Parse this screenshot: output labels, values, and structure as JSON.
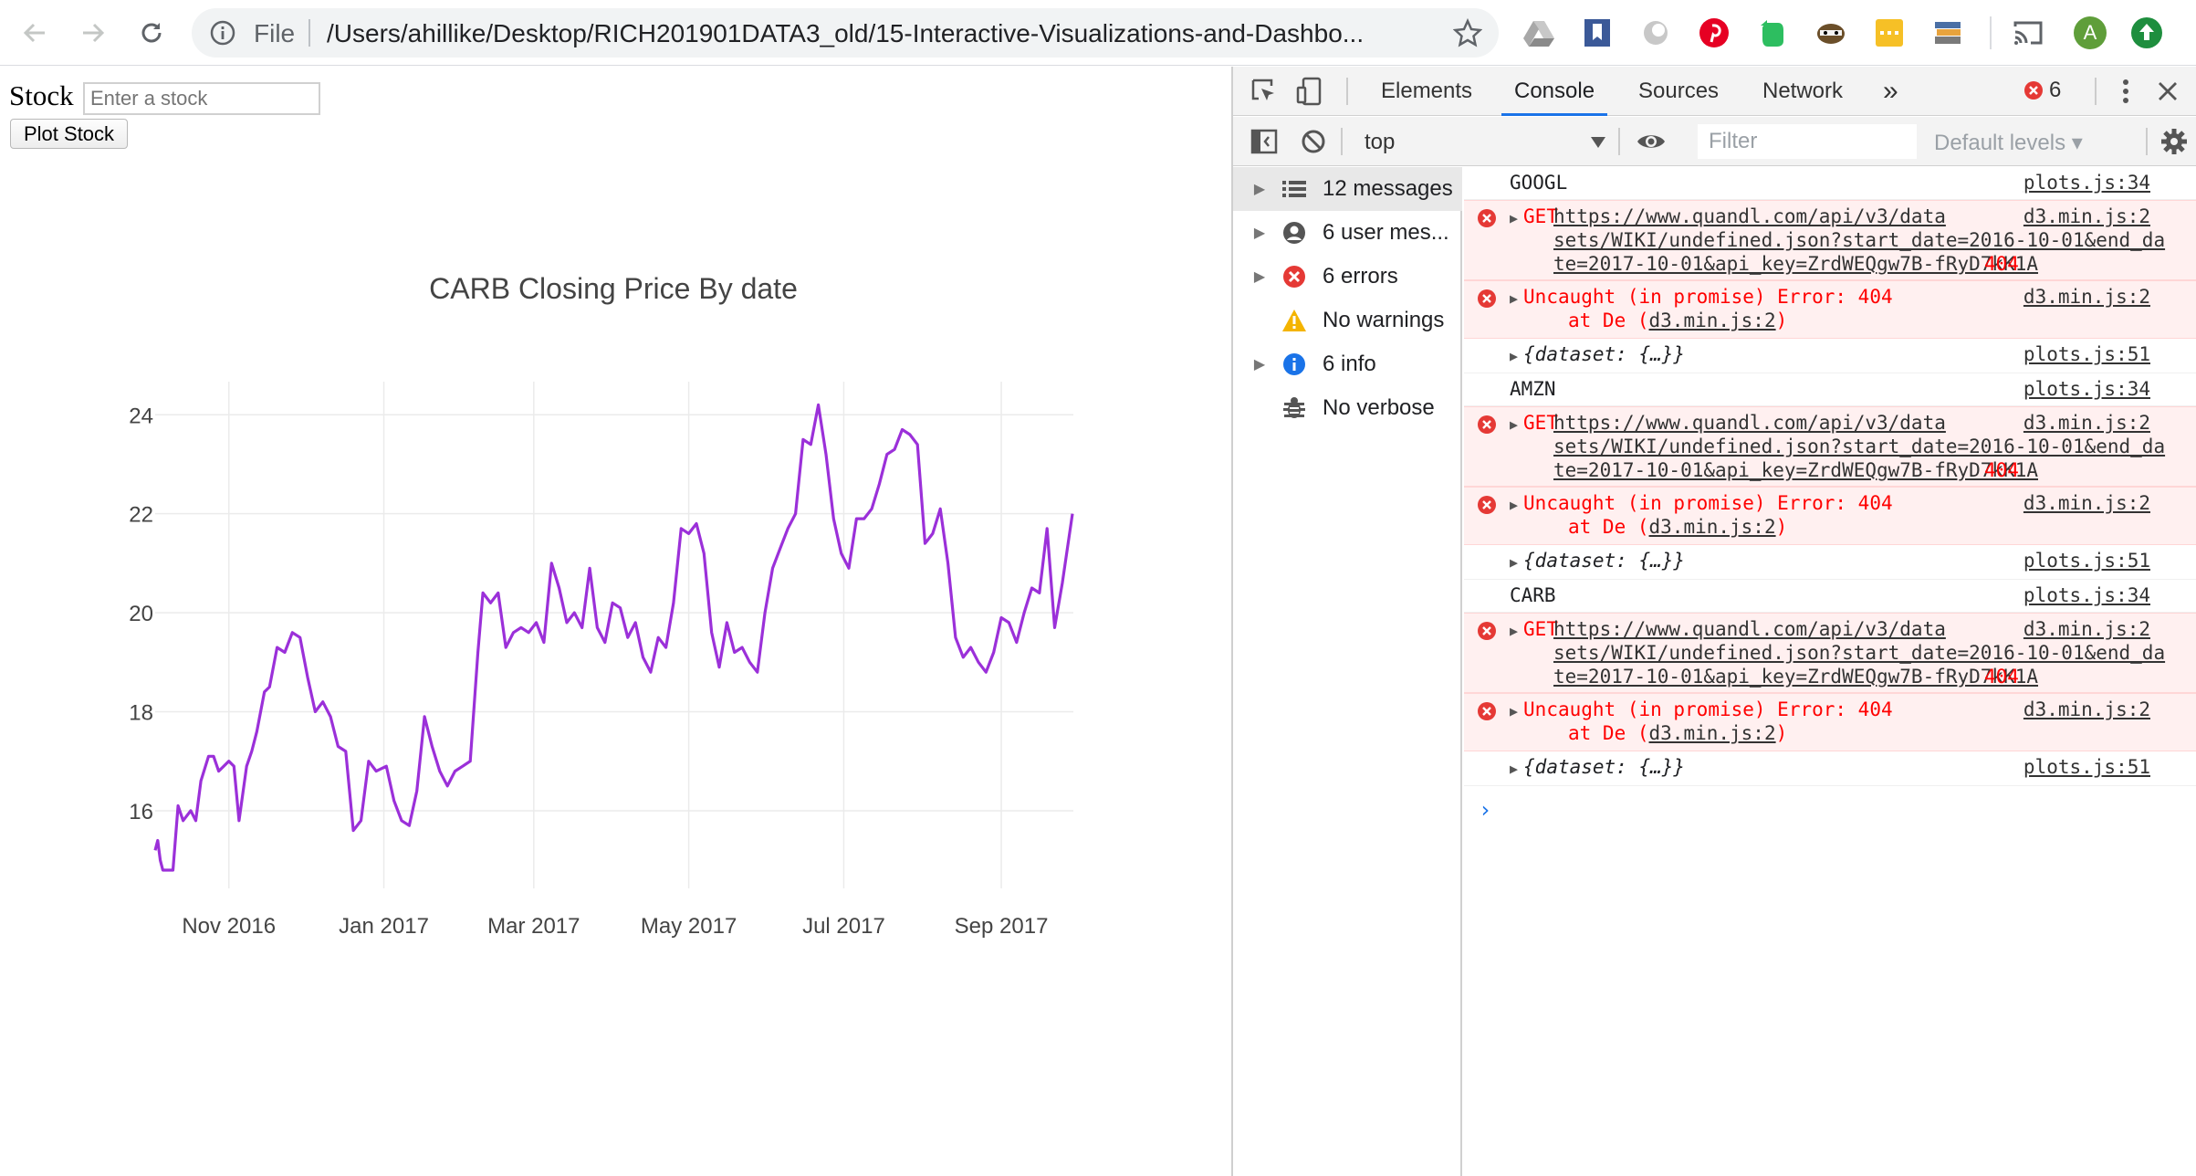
{
  "browser": {
    "file_label": "File",
    "url": "/Users/ahillike/Desktop/RICH201901DATA3_old/15-Interactive-Visualizations-and-Dashbo...",
    "profile_initial": "A"
  },
  "page": {
    "stock_label": "Stock",
    "stock_placeholder": "Enter a stock",
    "plot_button": "Plot Stock"
  },
  "chart_data": {
    "type": "line",
    "title": "CARB Closing Price By date",
    "color": "#9b30d9",
    "x_ticks": [
      "Nov 2016",
      "Jan 2017",
      "Mar 2017",
      "May 2017",
      "Jul 2017",
      "Sep 2017"
    ],
    "y_ticks": [
      16,
      18,
      20,
      22,
      24
    ],
    "ylim": [
      14.8,
      24.3
    ],
    "xlim": [
      "2016-10-03",
      "2017-09-29"
    ],
    "series": [
      {
        "x": [
          "2016-10-03",
          "2016-10-04",
          "2016-10-05",
          "2016-10-06",
          "2016-10-10",
          "2016-10-12",
          "2016-10-14",
          "2016-10-17",
          "2016-10-19",
          "2016-10-21",
          "2016-10-24",
          "2016-10-26",
          "2016-10-28",
          "2016-11-01",
          "2016-11-03",
          "2016-11-05",
          "2016-11-08",
          "2016-11-10",
          "2016-11-12",
          "2016-11-15",
          "2016-11-17",
          "2016-11-20",
          "2016-11-23",
          "2016-11-26",
          "2016-11-29",
          "2016-12-02",
          "2016-12-05",
          "2016-12-08",
          "2016-12-11",
          "2016-12-14",
          "2016-12-17",
          "2016-12-20",
          "2016-12-23",
          "2016-12-26",
          "2016-12-29",
          "2017-01-02",
          "2017-01-05",
          "2017-01-08",
          "2017-01-11",
          "2017-01-14",
          "2017-01-17",
          "2017-01-20",
          "2017-01-23",
          "2017-01-26",
          "2017-01-29",
          "2017-02-01",
          "2017-02-04",
          "2017-02-07",
          "2017-02-09",
          "2017-02-12",
          "2017-02-15",
          "2017-02-18",
          "2017-02-21",
          "2017-02-24",
          "2017-02-27",
          "2017-03-02",
          "2017-03-05",
          "2017-03-08",
          "2017-03-11",
          "2017-03-14",
          "2017-03-17",
          "2017-03-20",
          "2017-03-23",
          "2017-03-26",
          "2017-03-29",
          "2017-04-01",
          "2017-04-04",
          "2017-04-07",
          "2017-04-10",
          "2017-04-13",
          "2017-04-16",
          "2017-04-19",
          "2017-04-22",
          "2017-04-25",
          "2017-04-28",
          "2017-05-01",
          "2017-05-04",
          "2017-05-07",
          "2017-05-10",
          "2017-05-13",
          "2017-05-16",
          "2017-05-19",
          "2017-05-22",
          "2017-05-25",
          "2017-05-28",
          "2017-05-31",
          "2017-06-03",
          "2017-06-06",
          "2017-06-09",
          "2017-06-12",
          "2017-06-15",
          "2017-06-18",
          "2017-06-21",
          "2017-06-24",
          "2017-06-27",
          "2017-06-30",
          "2017-07-03",
          "2017-07-06",
          "2017-07-09",
          "2017-07-12",
          "2017-07-15",
          "2017-07-18",
          "2017-07-21",
          "2017-07-24",
          "2017-07-27",
          "2017-07-30",
          "2017-08-02",
          "2017-08-05",
          "2017-08-08",
          "2017-08-11",
          "2017-08-14",
          "2017-08-17",
          "2017-08-20",
          "2017-08-23",
          "2017-08-26",
          "2017-08-29",
          "2017-09-01",
          "2017-09-04",
          "2017-09-07",
          "2017-09-10",
          "2017-09-13",
          "2017-09-16",
          "2017-09-19",
          "2017-09-22",
          "2017-09-25",
          "2017-09-29"
        ],
        "y": [
          15.2,
          15.4,
          15.0,
          14.8,
          14.8,
          16.1,
          15.8,
          16.0,
          15.8,
          16.6,
          17.1,
          17.1,
          16.8,
          17.0,
          16.9,
          15.8,
          16.9,
          17.2,
          17.6,
          18.4,
          18.5,
          19.3,
          19.2,
          19.6,
          19.5,
          18.7,
          18.0,
          18.2,
          17.9,
          17.3,
          17.2,
          15.6,
          15.8,
          17.0,
          16.8,
          16.9,
          16.2,
          15.8,
          15.7,
          16.4,
          17.9,
          17.3,
          16.8,
          16.5,
          16.8,
          16.9,
          17.0,
          19.2,
          20.4,
          20.2,
          20.4,
          19.3,
          19.6,
          19.7,
          19.6,
          19.8,
          19.4,
          21.0,
          20.5,
          19.8,
          20.0,
          19.7,
          20.9,
          19.7,
          19.4,
          20.2,
          20.1,
          19.5,
          19.8,
          19.1,
          18.8,
          19.5,
          19.3,
          20.2,
          21.7,
          21.6,
          21.8,
          21.2,
          19.6,
          18.9,
          19.8,
          19.2,
          19.3,
          19.0,
          18.8,
          20.0,
          20.9,
          21.3,
          21.7,
          22.0,
          23.5,
          23.4,
          24.2,
          23.2,
          21.9,
          21.2,
          20.9,
          21.9,
          21.9,
          22.1,
          22.6,
          23.2,
          23.3,
          23.7,
          23.6,
          23.4,
          21.4,
          21.6,
          22.1,
          21.0,
          19.5,
          19.1,
          19.3,
          19.0,
          18.8,
          19.2,
          19.9,
          19.8,
          19.4,
          20.0,
          20.5,
          20.4,
          21.7,
          19.7,
          20.6,
          22.0
        ]
      }
    ]
  },
  "devtools": {
    "tabs": [
      "Elements",
      "Console",
      "Sources",
      "Network"
    ],
    "more_tabs": "»",
    "error_count": "6",
    "context": "top",
    "filter_placeholder": "Filter",
    "levels": "Default levels ▾",
    "sidebar": [
      {
        "label": "12 messages",
        "icon": "list-icon"
      },
      {
        "label": "6 user mes...",
        "icon": "user-icon"
      },
      {
        "label": "6 errors",
        "icon": "error-icon"
      },
      {
        "label": "No warnings",
        "icon": "warning-icon"
      },
      {
        "label": "6 info",
        "icon": "info-icon"
      },
      {
        "label": "No verbose",
        "icon": "bug-icon"
      }
    ],
    "messages": [
      {
        "kind": "log",
        "text": "GOOGL",
        "source": "plots.js:34"
      },
      {
        "kind": "get",
        "method": "GET",
        "url": "https://www.quandl.com/api/v3/data\nsets/WIKI/undefined.json?start_date=2016-10-01&end_da\nte=2017-10-01&api_key=ZrdWEQgw7B-fRyD7kK1A",
        "status": "404",
        "source": "d3.min.js:2"
      },
      {
        "kind": "uncaught",
        "text": "Uncaught (in promise) Error: 404",
        "at": "at De (",
        "at_link": "d3.min.js:2",
        "at_end": ")",
        "source": "d3.min.js:2"
      },
      {
        "kind": "obj",
        "text": "{dataset: {…}}",
        "source": "plots.js:51"
      },
      {
        "kind": "log",
        "text": "AMZN",
        "source": "plots.js:34"
      },
      {
        "kind": "get",
        "method": "GET",
        "url": "https://www.quandl.com/api/v3/data\nsets/WIKI/undefined.json?start_date=2016-10-01&end_da\nte=2017-10-01&api_key=ZrdWEQgw7B-fRyD7kK1A",
        "status": "404",
        "source": "d3.min.js:2"
      },
      {
        "kind": "uncaught",
        "text": "Uncaught (in promise) Error: 404",
        "at": "at De (",
        "at_link": "d3.min.js:2",
        "at_end": ")",
        "source": "d3.min.js:2"
      },
      {
        "kind": "obj",
        "text": "{dataset: {…}}",
        "source": "plots.js:51"
      },
      {
        "kind": "log",
        "text": "CARB",
        "source": "plots.js:34"
      },
      {
        "kind": "get",
        "method": "GET",
        "url": "https://www.quandl.com/api/v3/data\nsets/WIKI/undefined.json?start_date=2016-10-01&end_da\nte=2017-10-01&api_key=ZrdWEQgw7B-fRyD7kK1A",
        "status": "404",
        "source": "d3.min.js:2"
      },
      {
        "kind": "uncaught",
        "text": "Uncaught (in promise) Error: 404",
        "at": "at De (",
        "at_link": "d3.min.js:2",
        "at_end": ")",
        "source": "d3.min.js:2"
      },
      {
        "kind": "obj",
        "text": "{dataset: {…}}",
        "source": "plots.js:51"
      }
    ],
    "prompt": "›"
  }
}
